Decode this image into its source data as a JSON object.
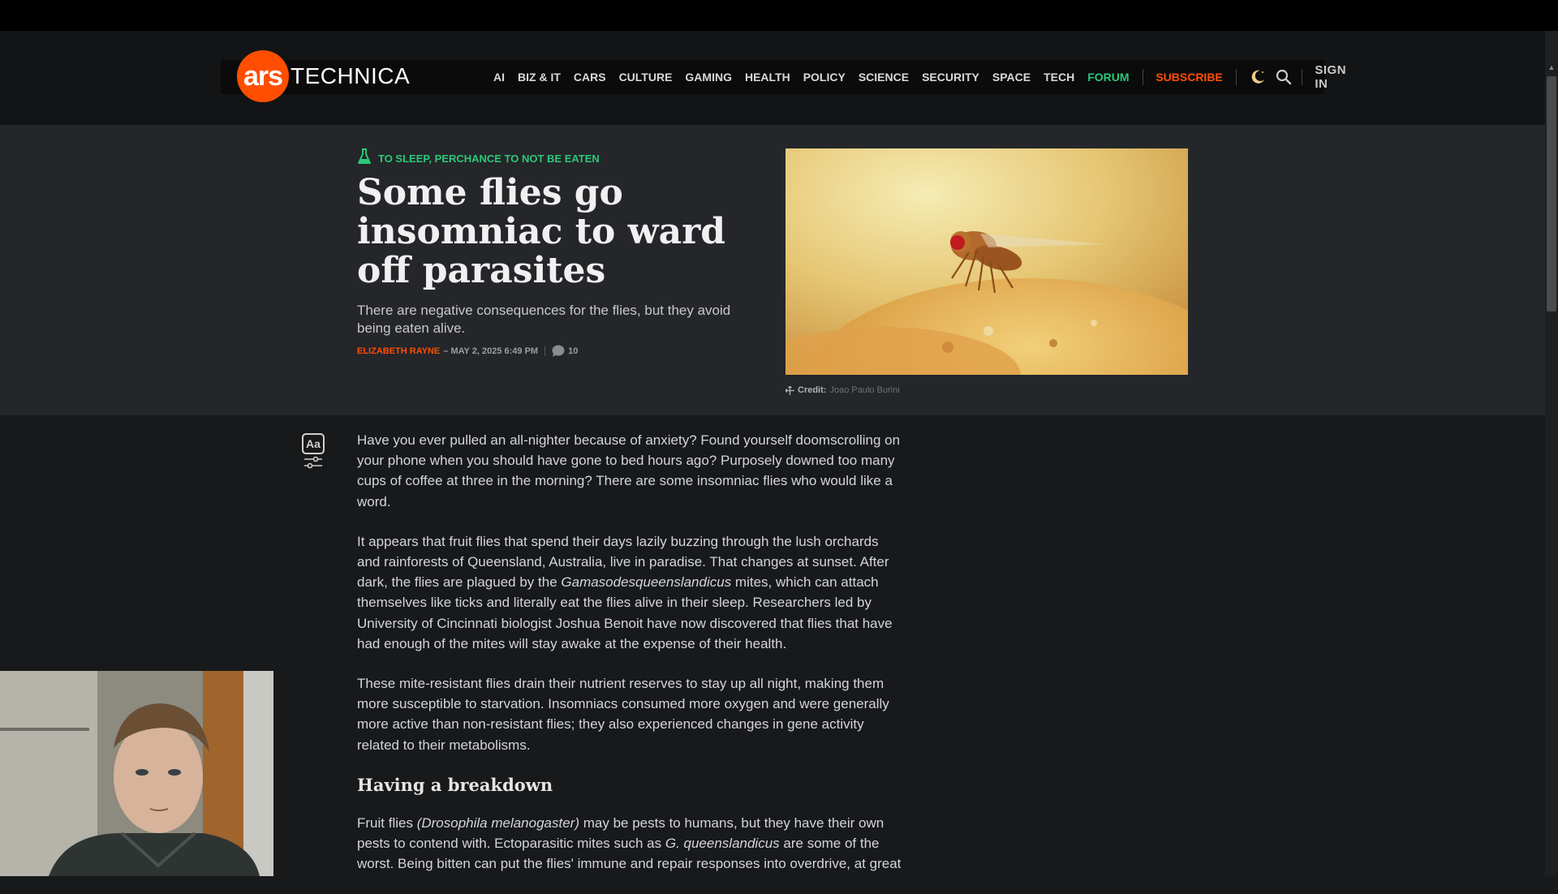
{
  "site": {
    "logo_mark": "ars",
    "logo_text": "TECHNICA"
  },
  "nav": {
    "items": [
      "AI",
      "BIZ & IT",
      "CARS",
      "CULTURE",
      "GAMING",
      "HEALTH",
      "POLICY",
      "SCIENCE",
      "SECURITY",
      "SPACE",
      "TECH"
    ],
    "forum": "FORUM",
    "subscribe": "SUBSCRIBE",
    "sign_in": "SIGN IN"
  },
  "article": {
    "kicker": "TO SLEEP, PERCHANCE TO NOT BE EATEN",
    "headline": "Some flies go insomniac to ward off parasites",
    "dek": "There are negative consequences for the flies, but they avoid being eaten alive.",
    "author": "ELIZABETH RAYNE",
    "date": "– MAY 2, 2025 6:49 PM",
    "comment_count": "10",
    "credit_label": "Credit:",
    "credit_name": "Joao Paulo Burini",
    "paragraphs": [
      "Have you ever pulled an all-nighter because of anxiety? Found yourself doomscrolling on your phone when you should have gone to bed hours ago? Purposely downed too many cups of coffee at three in the morning? There are some insomniac flies who would like a word.",
      {
        "before": "It appears that fruit flies that spend their days lazily buzzing through the lush orchards and rainforests of Queensland, Australia, live in paradise. That changes at sunset. After dark, the flies are plagued by the ",
        "italic": "Gamasodesqueenslandicus",
        "after": " mites, which can attach themselves like ticks and literally eat the flies alive in their sleep. Researchers led by University of Cincinnati biologist Joshua Benoit have now discovered that flies that have had enough of the mites will stay awake at the expense of their health."
      },
      "These mite-resistant flies drain their nutrient reserves to stay up all night, making them more susceptible to starvation. Insomniacs consumed more oxygen and were generally more active than non-resistant flies; they also experienced changes in gene activity related to their metabolisms."
    ],
    "subhead": "Having a breakdown",
    "p4": {
      "a": "Fruit flies ",
      "b": "(Drosophila melanogaster)",
      "c": " may be pests to humans, but they have their own pests to contend with. Ectoparasitic mites such as ",
      "d": "G. queenslandicus",
      "e": " are some of the worst. Being bitten can put the flies' immune and repair responses into overdrive, at great"
    }
  },
  "icons": {
    "kicker": "flask-icon",
    "theme": "moon-icon",
    "search": "search-icon",
    "comments": "comment-bubble-icon",
    "credit": "move-icon",
    "format": "text-format-icon"
  },
  "colors": {
    "brand": "#ff4e00",
    "accent_green": "#2bc878",
    "header_bg": "#131416",
    "hero_bg": "#24262a",
    "body_bg": "#18191b"
  }
}
